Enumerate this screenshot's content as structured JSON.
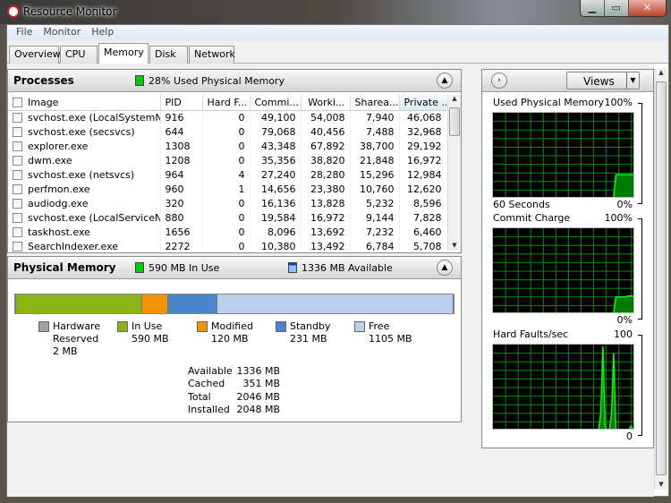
{
  "window": {
    "title": "Resource Monitor",
    "controls": [
      "minimize",
      "maximize",
      "close"
    ]
  },
  "menu": [
    "File",
    "Monitor",
    "Help"
  ],
  "tabs": [
    {
      "label": "Overview"
    },
    {
      "label": "CPU"
    },
    {
      "label": "Memory",
      "active": true
    },
    {
      "label": "Disk"
    },
    {
      "label": "Network"
    }
  ],
  "processes": {
    "title": "Processes",
    "summary": "28% Used Physical Memory",
    "columns": [
      "Image",
      "PID",
      "Hard F...",
      "Commi...",
      "Worki...",
      "Sharea...",
      "Private ..."
    ],
    "sorted_column": "Private ...",
    "rows": [
      [
        "svchost.exe (LocalSystemNet...",
        "916",
        "0",
        "49,100",
        "54,008",
        "7,940",
        "46,068"
      ],
      [
        "svchost.exe (secsvcs)",
        "644",
        "0",
        "79,068",
        "40,456",
        "7,488",
        "32,968"
      ],
      [
        "explorer.exe",
        "1308",
        "0",
        "43,348",
        "67,892",
        "38,700",
        "29,192"
      ],
      [
        "dwm.exe",
        "1208",
        "0",
        "35,356",
        "38,820",
        "21,848",
        "16,972"
      ],
      [
        "svchost.exe (netsvcs)",
        "964",
        "4",
        "27,240",
        "28,280",
        "15,296",
        "12,984"
      ],
      [
        "perfmon.exe",
        "960",
        "1",
        "14,656",
        "23,380",
        "10,760",
        "12,620"
      ],
      [
        "audiodg.exe",
        "320",
        "0",
        "16,136",
        "13,828",
        "5,232",
        "8,596"
      ],
      [
        "svchost.exe (LocalServiceNet...",
        "880",
        "0",
        "19,584",
        "16,972",
        "9,144",
        "7,828"
      ],
      [
        "taskhost.exe",
        "1656",
        "0",
        "8,096",
        "13,692",
        "7,232",
        "6,460"
      ],
      [
        "SearchIndexer.exe",
        "2272",
        "0",
        "10,380",
        "13,492",
        "6,784",
        "5,708"
      ]
    ]
  },
  "physical_memory": {
    "title": "Physical Memory",
    "in_use_summary": "590 MB In Use",
    "available_summary": "1336 MB Available",
    "bar": [
      {
        "name": "Hardware Reserved",
        "mb": 2,
        "color": "#a0a0a0"
      },
      {
        "name": "In Use",
        "mb": 590,
        "color": "#8cb414"
      },
      {
        "name": "Modified",
        "mb": 120,
        "color": "#f29400"
      },
      {
        "name": "Standby",
        "mb": 231,
        "color": "#4a86cc"
      },
      {
        "name": "Free",
        "mb": 1105,
        "color": "#b8d0ee"
      }
    ],
    "legend": [
      {
        "label": "Hardware",
        "label2": "Reserved",
        "value": "2 MB"
      },
      {
        "label": "In Use",
        "value": "590 MB"
      },
      {
        "label": "Modified",
        "value": "120 MB"
      },
      {
        "label": "Standby",
        "value": "231 MB"
      },
      {
        "label": "Free",
        "value": "1105 MB"
      }
    ],
    "stats": [
      {
        "label": "Available",
        "value": "1336 MB"
      },
      {
        "label": "Cached",
        "value": "351 MB"
      },
      {
        "label": "Total",
        "value": "2046 MB"
      },
      {
        "label": "Installed",
        "value": "2048 MB"
      }
    ]
  },
  "side": {
    "views_label": "Views",
    "graphs": [
      {
        "title": "Used Physical Memory",
        "max": "100%",
        "min": "0%",
        "footer": "60 Seconds",
        "values": [
          0,
          0,
          0,
          0,
          0,
          0,
          0,
          0,
          0,
          0,
          0,
          0,
          0,
          0,
          0,
          0,
          0,
          0,
          0,
          0,
          0,
          0,
          0,
          0,
          0,
          0,
          0,
          0,
          0,
          0,
          0,
          0,
          0,
          0,
          0,
          0,
          0,
          0,
          0,
          0,
          0,
          0,
          0,
          0,
          0,
          0,
          0,
          0,
          0,
          0,
          0,
          28,
          28,
          28,
          28,
          28,
          28,
          28,
          28,
          28
        ]
      },
      {
        "title": "Commit Charge",
        "max": "100%",
        "min": "0%",
        "values": [
          0,
          0,
          0,
          0,
          0,
          0,
          0,
          0,
          0,
          0,
          0,
          0,
          0,
          0,
          0,
          0,
          0,
          0,
          0,
          0,
          0,
          0,
          0,
          0,
          0,
          0,
          0,
          0,
          0,
          0,
          0,
          0,
          0,
          0,
          0,
          0,
          0,
          0,
          0,
          0,
          0,
          0,
          0,
          0,
          0,
          0,
          0,
          0,
          0,
          0,
          0,
          20,
          20,
          20,
          20,
          20,
          21,
          21,
          21,
          21
        ]
      },
      {
        "title": "Hard Faults/sec",
        "max": "100",
        "min": "0",
        "values": [
          0,
          0,
          0,
          0,
          0,
          0,
          0,
          0,
          0,
          0,
          0,
          0,
          0,
          0,
          0,
          0,
          0,
          0,
          0,
          0,
          0,
          0,
          0,
          0,
          0,
          0,
          0,
          0,
          0,
          0,
          0,
          0,
          0,
          0,
          0,
          0,
          0,
          0,
          0,
          0,
          0,
          0,
          0,
          0,
          0,
          0,
          0,
          0,
          0,
          0,
          20,
          98,
          5,
          0,
          0,
          20,
          90,
          0,
          0,
          0,
          0,
          0,
          0,
          0,
          5,
          0,
          0
        ]
      }
    ]
  },
  "colors": {
    "graph_line": "#00ff00",
    "graph_fill": "#007a00",
    "graph_grid": "#008c00"
  }
}
